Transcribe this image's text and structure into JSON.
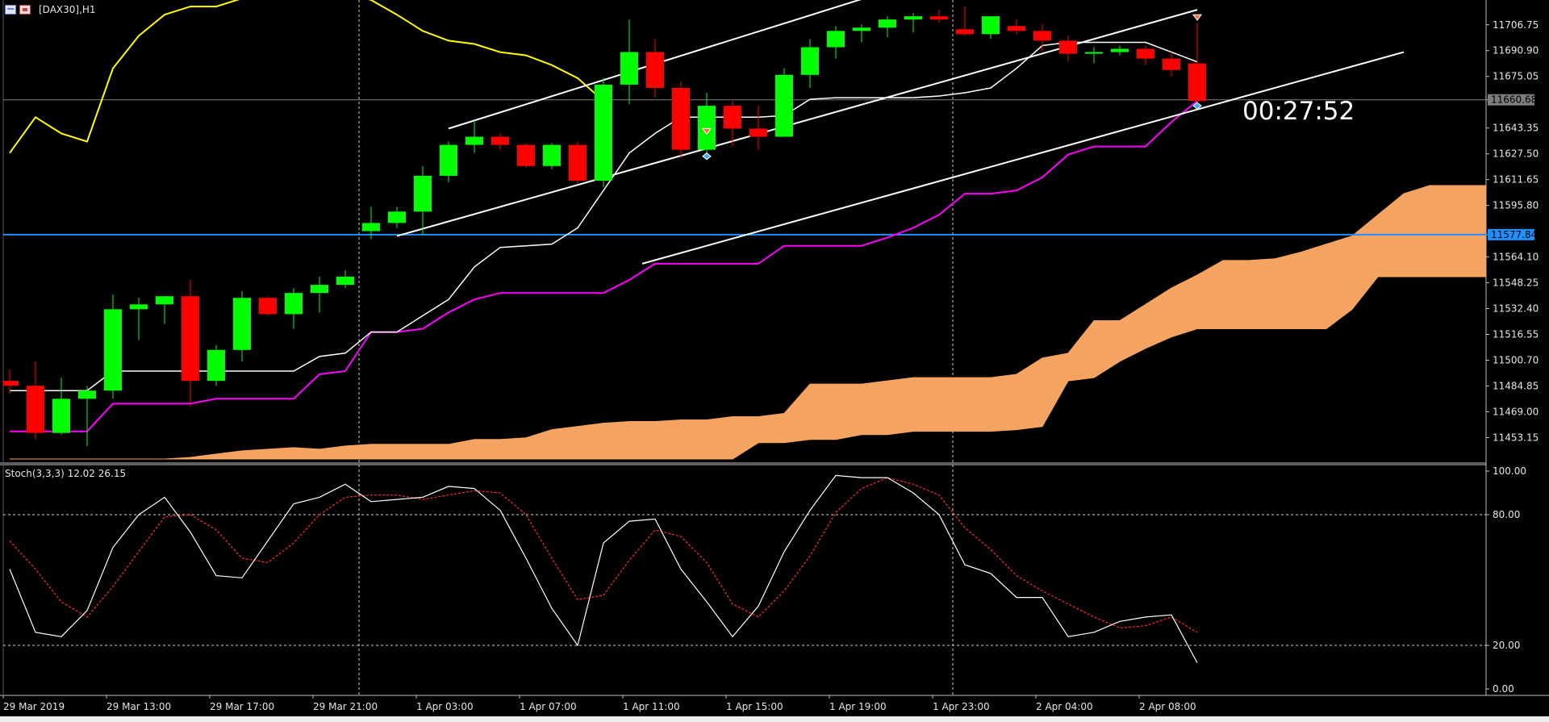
{
  "header": {
    "symbol": "[DAX30],H1"
  },
  "countdown": "00:27:52",
  "colors": {
    "background": "#000000",
    "bull": "#00ff00",
    "bear": "#ff0000",
    "kijun": "#ff00ff",
    "tenkan": "#ffffff",
    "chikou": "#ffff00",
    "cloud": "#f4a460",
    "hline_current": "#808080",
    "hline_level": "#1e90ff",
    "stoch_main": "#ffffff",
    "stoch_signal": "#ff2a2a"
  },
  "chart_data": [
    {
      "type": "candlestick",
      "name": "price",
      "title": "[DAX30],H1",
      "x_labels": [
        "29 Mar 2019",
        "29 Mar 13:00",
        "29 Mar 17:00",
        "29 Mar 21:00",
        "1 Apr 03:00",
        "1 Apr 07:00",
        "1 Apr 11:00",
        "1 Apr 15:00",
        "1 Apr 19:00",
        "1 Apr 23:00",
        "2 Apr 04:00",
        "2 Apr 08:00"
      ],
      "y_ticks": [
        "11706.75",
        "11690.90",
        "11675.05",
        "11660.68",
        "11643.35",
        "11627.50",
        "11611.65",
        "11595.80",
        "11577.84",
        "11564.10",
        "11548.25",
        "11532.40",
        "11516.55",
        "11500.70",
        "11484.85",
        "11469.00",
        "11453.15"
      ],
      "ylim": [
        11438,
        11722
      ],
      "current_price": "11660.68",
      "level_price": "11577.84",
      "candles": [
        {
          "o": 11488,
          "h": 11495,
          "l": 11480,
          "c": 11485
        },
        {
          "o": 11485,
          "h": 11500,
          "l": 11452,
          "c": 11456
        },
        {
          "o": 11456,
          "h": 11490,
          "l": 11455,
          "c": 11477
        },
        {
          "o": 11477,
          "h": 11485,
          "l": 11448,
          "c": 11482
        },
        {
          "o": 11482,
          "h": 11541,
          "l": 11477,
          "c": 11532
        },
        {
          "o": 11532,
          "h": 11539,
          "l": 11513,
          "c": 11535
        },
        {
          "o": 11535,
          "h": 11540,
          "l": 11523,
          "c": 11540
        },
        {
          "o": 11540,
          "h": 11550,
          "l": 11472,
          "c": 11488
        },
        {
          "o": 11488,
          "h": 11510,
          "l": 11485,
          "c": 11507
        },
        {
          "o": 11507,
          "h": 11543,
          "l": 11500,
          "c": 11539
        },
        {
          "o": 11539,
          "h": 11540,
          "l": 11528,
          "c": 11529
        },
        {
          "o": 11529,
          "h": 11545,
          "l": 11520,
          "c": 11542
        },
        {
          "o": 11542,
          "h": 11552,
          "l": 11530,
          "c": 11547
        },
        {
          "o": 11547,
          "h": 11556,
          "l": 11545,
          "c": 11552
        },
        {
          "o": 11580,
          "h": 11595,
          "l": 11575,
          "c": 11585
        },
        {
          "o": 11585,
          "h": 11595,
          "l": 11582,
          "c": 11592
        },
        {
          "o": 11592,
          "h": 11620,
          "l": 11578,
          "c": 11614
        },
        {
          "o": 11614,
          "h": 11635,
          "l": 11610,
          "c": 11633
        },
        {
          "o": 11633,
          "h": 11648,
          "l": 11628,
          "c": 11638
        },
        {
          "o": 11638,
          "h": 11640,
          "l": 11630,
          "c": 11633
        },
        {
          "o": 11633,
          "h": 11634,
          "l": 11619,
          "c": 11620
        },
        {
          "o": 11620,
          "h": 11634,
          "l": 11618,
          "c": 11633
        },
        {
          "o": 11633,
          "h": 11635,
          "l": 11609,
          "c": 11611
        },
        {
          "o": 11611,
          "h": 11674,
          "l": 11607,
          "c": 11670
        },
        {
          "o": 11670,
          "h": 11710,
          "l": 11658,
          "c": 11690
        },
        {
          "o": 11690,
          "h": 11698,
          "l": 11662,
          "c": 11668
        },
        {
          "o": 11668,
          "h": 11672,
          "l": 11625,
          "c": 11630
        },
        {
          "o": 11630,
          "h": 11665,
          "l": 11628,
          "c": 11657
        },
        {
          "o": 11657,
          "h": 11660,
          "l": 11632,
          "c": 11643
        },
        {
          "o": 11643,
          "h": 11657,
          "l": 11630,
          "c": 11638
        },
        {
          "o": 11638,
          "h": 11680,
          "l": 11638,
          "c": 11676
        },
        {
          "o": 11676,
          "h": 11698,
          "l": 11668,
          "c": 11693
        },
        {
          "o": 11693,
          "h": 11706,
          "l": 11686,
          "c": 11703
        },
        {
          "o": 11703,
          "h": 11707,
          "l": 11696,
          "c": 11705
        },
        {
          "o": 11705,
          "h": 11712,
          "l": 11699,
          "c": 11710
        },
        {
          "o": 11710,
          "h": 11714,
          "l": 11702,
          "c": 11712
        },
        {
          "o": 11712,
          "h": 11716,
          "l": 11708,
          "c": 11710
        },
        {
          "o": 11704,
          "h": 11718,
          "l": 11700,
          "c": 11701
        },
        {
          "o": 11701,
          "h": 11712,
          "l": 11698,
          "c": 11712
        },
        {
          "o": 11706,
          "h": 11710,
          "l": 11701,
          "c": 11703
        },
        {
          "o": 11703,
          "h": 11707,
          "l": 11690,
          "c": 11697
        },
        {
          "o": 11697,
          "h": 11700,
          "l": 11684,
          "c": 11689
        },
        {
          "o": 11689,
          "h": 11693,
          "l": 11683,
          "c": 11690
        },
        {
          "o": 11690,
          "h": 11694,
          "l": 11688,
          "c": 11692
        },
        {
          "o": 11692,
          "h": 11694,
          "l": 11682,
          "c": 11686
        },
        {
          "o": 11686,
          "h": 11690,
          "l": 11675,
          "c": 11679
        },
        {
          "o": 11683,
          "h": 11708,
          "l": 11657,
          "c": 11660
        }
      ],
      "tenkan": [
        11482,
        11482,
        11482,
        11482,
        11494,
        11494,
        11494,
        11494,
        11494,
        11494,
        11494,
        11494,
        11503,
        11505,
        11518,
        11518,
        11528,
        11538,
        11558,
        11570,
        11571,
        11572,
        11582,
        11605,
        11628,
        11640,
        11650,
        11650,
        11650,
        11650,
        11651,
        11661,
        11662,
        11662,
        11662,
        11662,
        11663,
        11665,
        11668,
        11680,
        11694,
        11696,
        11696,
        11696,
        11696,
        11690,
        11684
      ],
      "kijun": [
        11457,
        11457,
        11457,
        11457,
        11474,
        11474,
        11474,
        11474,
        11477,
        11477,
        11477,
        11477,
        11492,
        11494,
        11518,
        11518,
        11520,
        11530,
        11538,
        11542,
        11542,
        11542,
        11542,
        11542,
        11550,
        11560,
        11560,
        11560,
        11560,
        11560,
        11571,
        11571,
        11571,
        11571,
        11576,
        11582,
        11590,
        11603,
        11603,
        11605,
        11613,
        11627,
        11632,
        11632,
        11632,
        11647,
        11660
      ],
      "chikou": [
        11628,
        11650,
        11640,
        11635,
        11680,
        11700,
        11713,
        11718,
        11718,
        11723,
        11730,
        11730,
        11726,
        11727,
        11722,
        11713,
        11703,
        11697,
        11695,
        11690,
        11688,
        11682,
        11674,
        11660
      ],
      "senkou_a": [
        11440,
        11440,
        11440,
        11440,
        11440,
        11440,
        11440,
        11441,
        11443,
        11445,
        11446,
        11447,
        11446,
        11448,
        11449,
        11449,
        11449,
        11449,
        11452,
        11452,
        11453,
        11458,
        11460,
        11462,
        11463,
        11463,
        11464,
        11464,
        11466,
        11466,
        11468,
        11486,
        11486,
        11486,
        11488,
        11490,
        11490,
        11490,
        11490,
        11492,
        11502,
        11505,
        11525,
        11525,
        11535,
        11545,
        11553,
        11562,
        11562,
        11563,
        11567,
        11572,
        11577,
        11590,
        11603,
        11608,
        11608,
        11608,
        11608,
        11612,
        11613,
        11613,
        11613,
        11614
      ],
      "senkou_b": [
        11440,
        11440,
        11440,
        11440,
        11440,
        11440,
        11440,
        11440,
        11440,
        11440,
        11440,
        11440,
        11440,
        11440,
        11440,
        11440,
        11440,
        11440,
        11440,
        11440,
        11440,
        11440,
        11440,
        11440,
        11440,
        11440,
        11440,
        11440,
        11440,
        11450,
        11450,
        11452,
        11452,
        11455,
        11455,
        11457,
        11457,
        11457,
        11457,
        11458,
        11460,
        11488,
        11490,
        11500,
        11508,
        11515,
        11520,
        11520,
        11520,
        11520,
        11520,
        11520,
        11532,
        11552,
        11552,
        11552,
        11552,
        11552,
        11552,
        11552,
        11553,
        11556,
        11558,
        11558
      ],
      "channel_lines": [
        {
          "x1": 17.0,
          "y1": 11643,
          "x2": 34.5,
          "y2": 11730
        },
        {
          "x1": 15.0,
          "y1": 11577,
          "x2": 46.0,
          "y2": 11716
        },
        {
          "x1": 24.5,
          "y1": 11560,
          "x2": 54.0,
          "y2": 11690
        }
      ],
      "arrows": [
        {
          "i": 27,
          "price": 11641,
          "kind": "sell"
        },
        {
          "i": 27,
          "price": 11626,
          "kind": "buy"
        },
        {
          "i": 46,
          "price": 11711,
          "kind": "sell"
        },
        {
          "i": 46,
          "price": 11657,
          "kind": "buy"
        }
      ],
      "vlines": [
        14,
        37
      ]
    },
    {
      "type": "line",
      "name": "stochastic",
      "title": "Stoch(3,3,3) 12.02 26.15",
      "y_ticks": [
        "100.00",
        "80.00",
        "20.00",
        "0.00"
      ],
      "ylim": [
        0,
        100
      ],
      "levels": [
        80,
        20
      ],
      "series": [
        {
          "values": [
            55,
            26,
            24,
            36,
            65,
            80,
            88,
            72,
            52,
            51,
            68,
            85,
            88,
            94,
            86,
            87,
            88,
            93,
            92,
            82,
            60,
            37,
            20,
            67,
            77,
            78,
            55,
            40,
            24,
            38,
            63,
            82,
            98,
            97,
            97,
            90,
            80,
            57,
            53,
            42,
            42,
            24,
            26,
            31,
            33,
            34,
            12
          ]
        },
        {
          "values": [
            68,
            55,
            40,
            33,
            47,
            63,
            79,
            80,
            73,
            60,
            58,
            67,
            80,
            88,
            89,
            89,
            87,
            89,
            91,
            90,
            80,
            60,
            41,
            43,
            59,
            73,
            70,
            58,
            39,
            33,
            45,
            61,
            81,
            92,
            97,
            94,
            89,
            74,
            64,
            52,
            45,
            39,
            33,
            28,
            29,
            33,
            26
          ]
        }
      ]
    }
  ]
}
